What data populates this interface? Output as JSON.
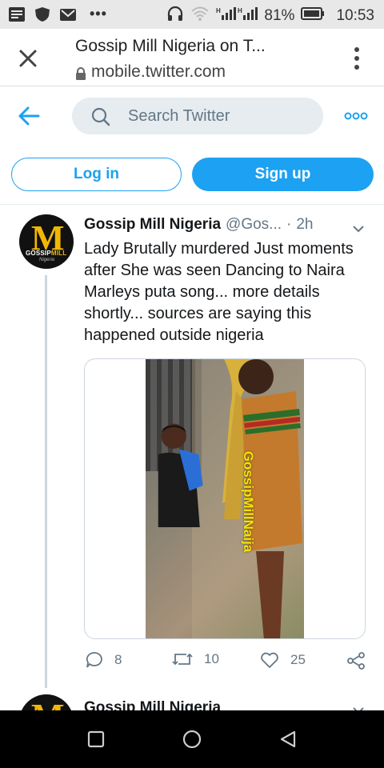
{
  "status_bar": {
    "battery": "81%",
    "time": "10:53",
    "icons": [
      "notification-icon",
      "shield-icon",
      "mail-icon",
      "more-dots",
      "headphones-icon",
      "wifi-icon",
      "signal-icon",
      "battery-icon"
    ],
    "more": "•••"
  },
  "browser": {
    "title": "Gossip Mill Nigeria on T...",
    "url": "mobile.twitter.com"
  },
  "twitter_header": {
    "search_placeholder": "Search Twitter"
  },
  "auth": {
    "login_label": "Log in",
    "signup_label": "Sign up"
  },
  "tweet": {
    "name": "Gossip Mill Nigeria",
    "handle": "@Gos...",
    "separator": "·",
    "time": "2h",
    "text": "Lady Brutally murdered Just moments after She was seen Dancing to Naira Marleys puta song... more details shortly... sources are saying this happened outside nigeria",
    "avatar": {
      "letter": "M",
      "brand_a": "GOSSIP",
      "brand_b": "MILL",
      "brand_c": "Nigeria"
    },
    "media_watermark": "GossipMillNaija",
    "replies": "8",
    "retweets": "10",
    "likes": "25"
  },
  "next_tweet": {
    "name": "Gossip Mill Nigeria",
    "avatar_letter": "M"
  },
  "colors": {
    "accent": "#1da1f2",
    "muted": "#657786",
    "brand_yellow": "#f2b705"
  }
}
